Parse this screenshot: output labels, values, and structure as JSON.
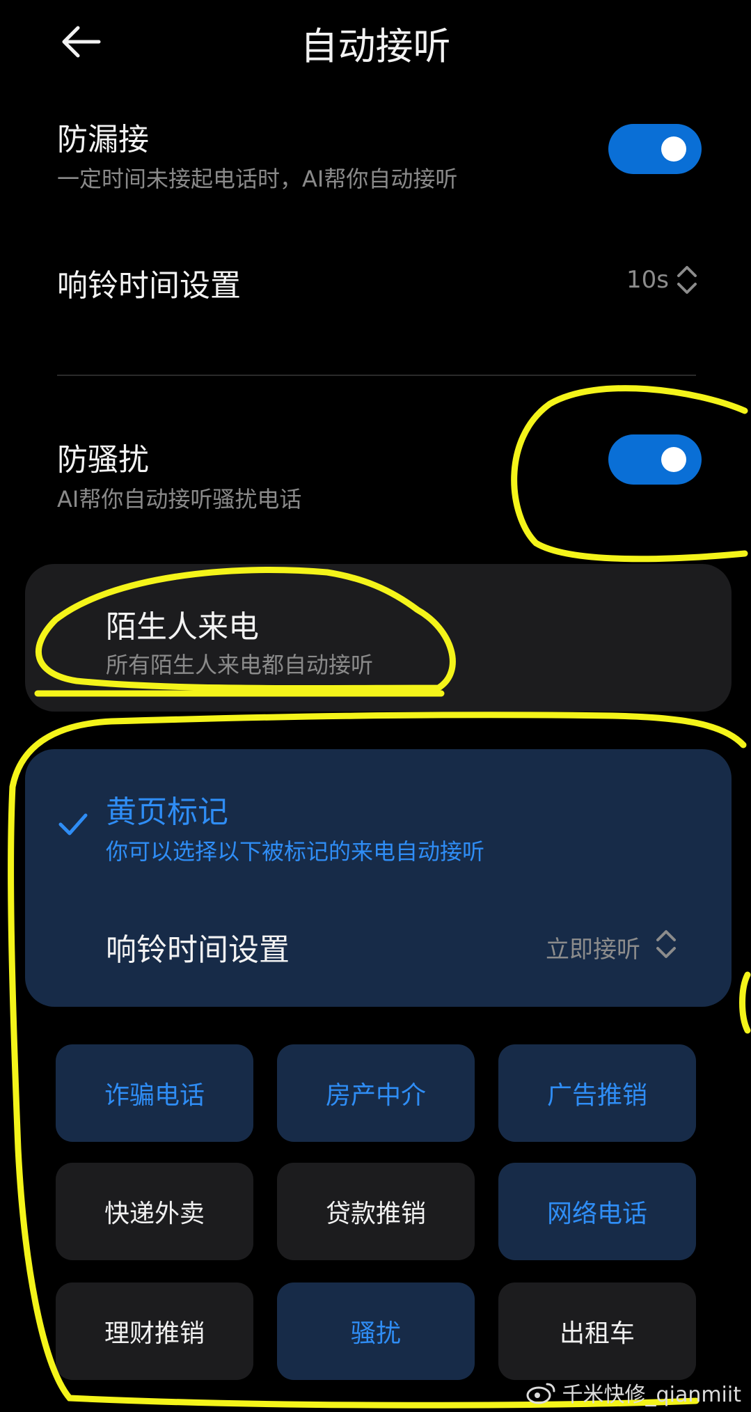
{
  "header": {
    "title": "自动接听"
  },
  "anti_miss": {
    "title": "防漏接",
    "subtitle": "一定时间未接起电话时，AI帮你自动接听",
    "enabled": true
  },
  "ring_time_1": {
    "label": "响铃时间设置",
    "value": "10s"
  },
  "anti_harass": {
    "title": "防骚扰",
    "subtitle": "AI帮你自动接听骚扰电话",
    "enabled": true
  },
  "stranger_calls": {
    "title": "陌生人来电",
    "subtitle": "所有陌生人来电都自动接听"
  },
  "yellow_pages": {
    "title": "黄页标记",
    "subtitle": "你可以选择以下被标记的来电自动接听",
    "checked": true,
    "ring_time_label": "响铃时间设置",
    "ring_time_value": "立即接听"
  },
  "categories": [
    {
      "label": "诈骗电话",
      "selected": true
    },
    {
      "label": "房产中介",
      "selected": true
    },
    {
      "label": "广告推销",
      "selected": true
    },
    {
      "label": "快递外卖",
      "selected": false
    },
    {
      "label": "贷款推销",
      "selected": false
    },
    {
      "label": "网络电话",
      "selected": true
    },
    {
      "label": "理财推销",
      "selected": false
    },
    {
      "label": "骚扰",
      "selected": true
    },
    {
      "label": "出租车",
      "selected": false
    }
  ],
  "watermark": {
    "text": "千米快修_qianmiit"
  },
  "colors": {
    "accent": "#0a6fd6",
    "selected_text": "#2f8df5",
    "selected_bg": "#172b48",
    "annotation": "#f4f41a"
  }
}
